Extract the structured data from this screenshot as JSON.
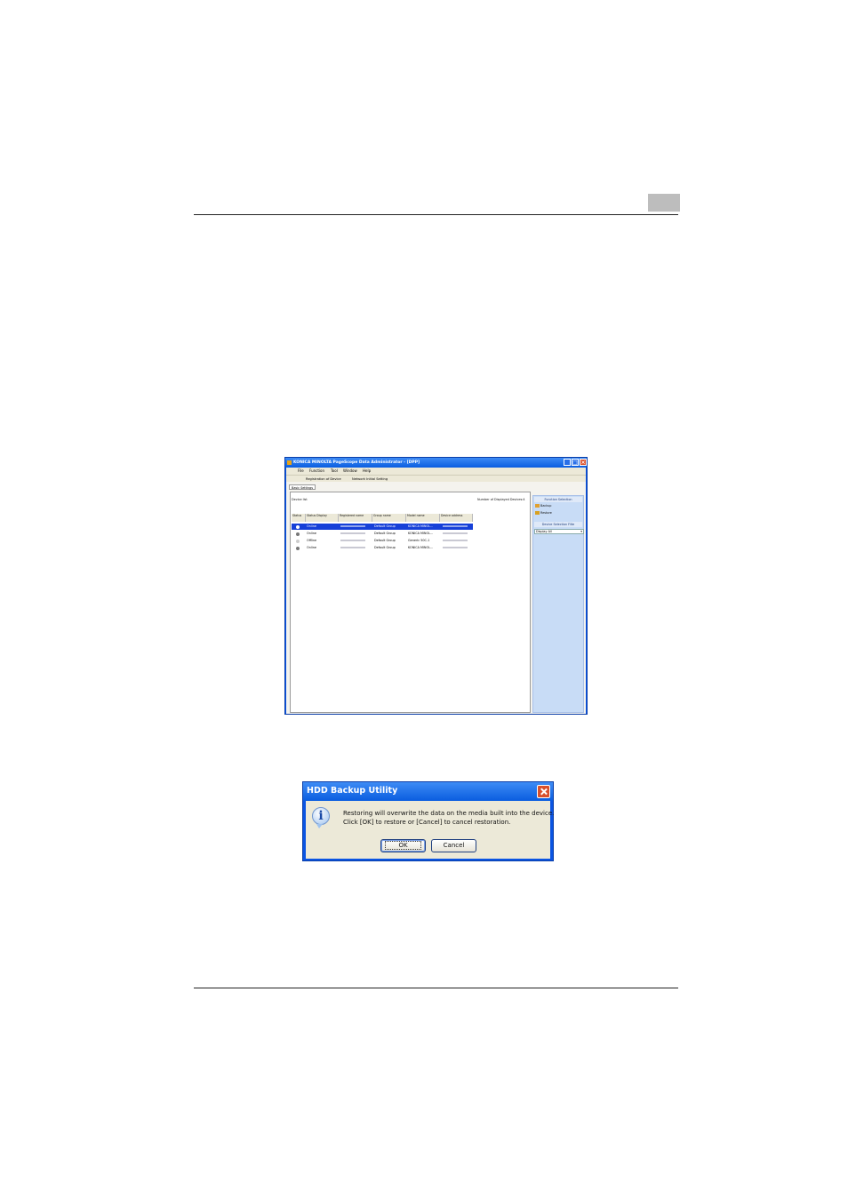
{
  "app_window": {
    "title": "KONICA MINOLTA PageScope Data Administrator - [DPP]",
    "menu": [
      "File",
      "Function",
      "Tool",
      "Window",
      "Help"
    ],
    "toolbar": {
      "registration": "Registration of Device",
      "network": "Network Initial Setting"
    },
    "tab": "Basic Settings",
    "device_list_label": "Device list",
    "displayed_count_label": "Number of Displayed Devices:4",
    "columns": [
      "Status",
      "Status Display",
      "Registered name",
      "Group name",
      "Model name",
      "Device address"
    ],
    "rows": [
      {
        "status_display": "Online",
        "group": "Default Group",
        "model": "KONICA MINOL...",
        "selected": true
      },
      {
        "status_display": "Online",
        "group": "Default Group",
        "model": "KONICA MINOL...",
        "selected": false
      },
      {
        "status_display": "Offline",
        "group": "Default Group",
        "model": "Generic 50C-1",
        "selected": false
      },
      {
        "status_display": "Online",
        "group": "Default Group",
        "model": "KONICA MINOL...",
        "selected": false
      }
    ],
    "side": {
      "function_selection": "Function Selection",
      "backup": "Backup",
      "restore": "Restore",
      "filter_title": "Device Selection Filte",
      "filter_value": "Display All"
    }
  },
  "dialog": {
    "title": "HDD Backup Utility",
    "message_line1": "Restoring will overwrite the data on the media built into the device.",
    "message_line2": "Click [OK] to restore or [Cancel] to cancel restoration.",
    "ok_label": "OK",
    "cancel_label": "Cancel"
  }
}
